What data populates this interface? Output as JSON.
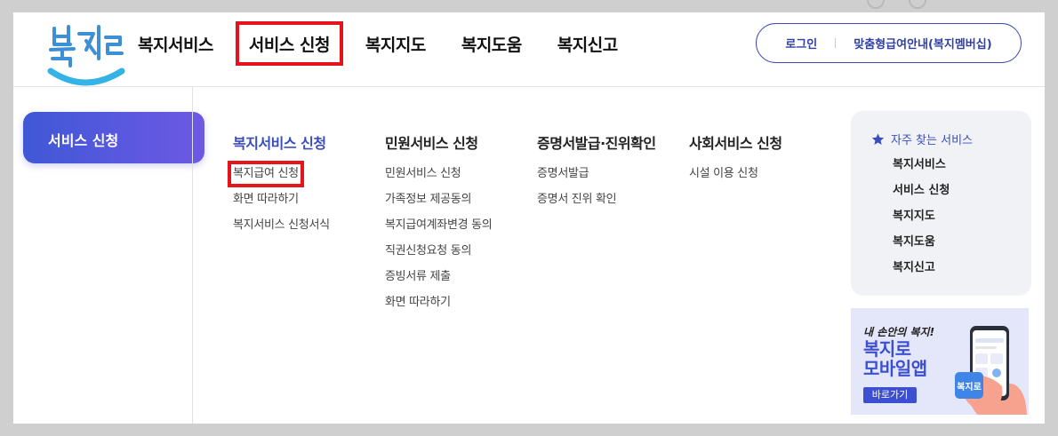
{
  "header": {
    "logo_text": "복지로",
    "nav": [
      "복지서비스",
      "서비스 신청",
      "복지지도",
      "복지도움",
      "복지신고"
    ],
    "highlighted_nav_index": 1,
    "util": {
      "login": "로그인",
      "guide": "맞춤형급여안내(복지멤버십)"
    }
  },
  "side": {
    "current": "서비스 신청"
  },
  "menu": {
    "columns": [
      {
        "title": "복지서비스 신청",
        "items": [
          "복지급여 신청",
          "화면 따라하기",
          "복지서비스 신청서식"
        ]
      },
      {
        "title": "민원서비스 신청",
        "items": [
          "민원서비스 신청",
          "가족정보 제공동의",
          "복지급여계좌변경 동의",
          "직권신청요청 동의",
          "증빙서류 제출",
          "화면 따라하기"
        ]
      },
      {
        "title": "증명서발급·진위확인",
        "items": [
          "증명서발급",
          "증명서 진위 확인"
        ]
      },
      {
        "title": "사회서비스 신청",
        "items": [
          "시설 이용 신청"
        ]
      }
    ]
  },
  "favorites": {
    "title": "자주 찾는 서비스",
    "items": [
      "복지서비스",
      "서비스 신청",
      "복지지도",
      "복지도움",
      "복지신고"
    ]
  },
  "banner": {
    "subtitle": "내 손안의 복지!",
    "line1": "복지로",
    "line2": "모바일앱",
    "button": "바로가기"
  },
  "colors": {
    "accent": "#3a4dbf",
    "highlight_box": "#e5131a"
  }
}
